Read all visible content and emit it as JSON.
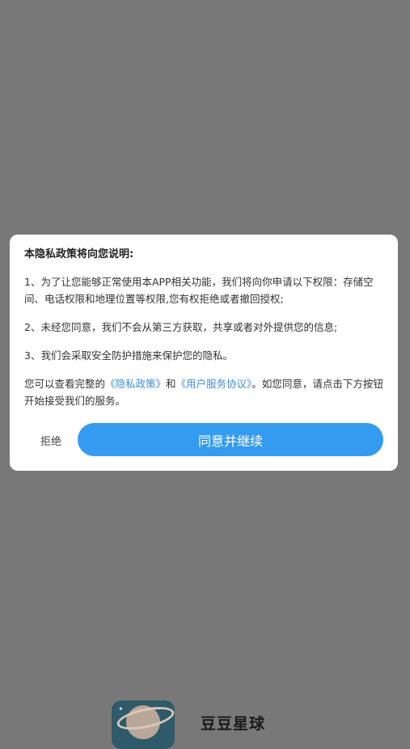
{
  "dialog": {
    "title": "本隐私政策将向您说明:",
    "item1": "1、为了让您能够正常使用本APP相关功能，我们将向你申请以下权限：存储空间、电话权限和地理位置等权限,您有权拒绝或者撤回授权;",
    "item2": "2、未经您同意，我们不会从第三方获取，共享或者对外提供您的信息;",
    "item3": "3、我们会采取安全防护措施来保护您的隐私。",
    "notice_prefix": "您可以查看完整的",
    "privacy_link": "《隐私政策》",
    "notice_and": "和",
    "terms_link": "《用户服务协议》",
    "notice_suffix": "。如您同意，请点击下方按钮开始接受我们的服务。",
    "reject_label": "拒绝",
    "agree_label": "同意并继续"
  },
  "brand": {
    "app_name": "豆豆星球",
    "logo_icon": "planet-icon"
  },
  "colors": {
    "overlay": "#787878",
    "accent": "#349bf0",
    "link": "#3f8fd8"
  }
}
